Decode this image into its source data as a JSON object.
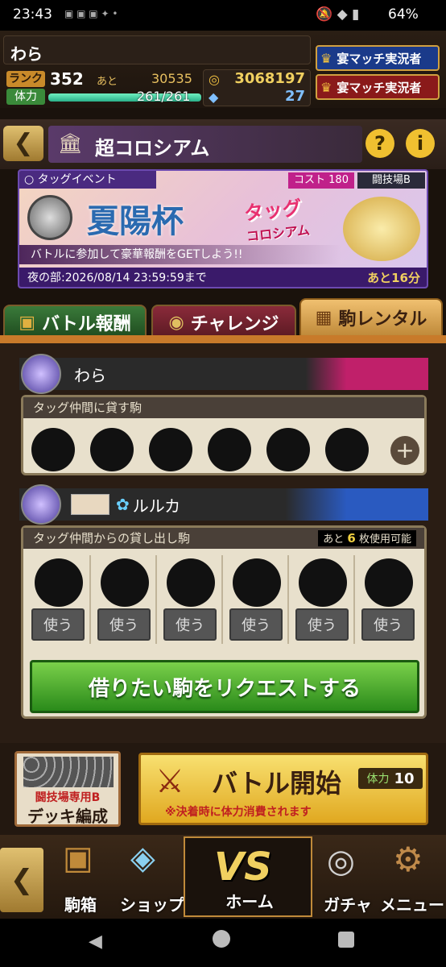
{
  "status": {
    "time": "23:43",
    "battery": "64%"
  },
  "player": {
    "name": "わら",
    "rank_label": "ランク",
    "rank": "352",
    "next_label": "あと",
    "next_value": "30535",
    "stamina_label": "体力",
    "stamina": "261/261",
    "stamina_fraction": 1.0,
    "coins": "3068197",
    "gems": "27"
  },
  "badges": [
    "宴マッチ実況者",
    "宴マッチ実況者"
  ],
  "title": {
    "text": "超コロシアム"
  },
  "banner": {
    "tag": "タッグイベント",
    "cost_label": "コスト",
    "cost": "180",
    "arena": "闘技場B",
    "event_name": "夏陽杯",
    "logo_line1": "タッグ",
    "logo_line2": "コロシアム",
    "subtitle": "バトルに参加して豪華報酬をGETしよう!!",
    "period": "夜の部:2026/08/14 23:59:59まで",
    "remaining": "あと16分"
  },
  "tabs": [
    {
      "label": "バトル報酬"
    },
    {
      "label": "チャレンジ"
    },
    {
      "label": "駒レンタル"
    }
  ],
  "me": {
    "name": "わら",
    "section_label": "タッグ仲間に貸す駒"
  },
  "partner": {
    "name": "ルルカ",
    "section_label": "タッグ仲間からの貸し出し駒",
    "remain_prefix": "あと",
    "remain_count": "6",
    "remain_suffix": "枚使用可能",
    "use_label": "使う"
  },
  "request_button": "借りたい駒をリクエストする",
  "deck": {
    "line1": "闘技場専用B",
    "line2": "デッキ編成"
  },
  "battle": {
    "label": "バトル開始",
    "note": "※決着時に体力消費されます",
    "stamina_label": "体力",
    "stamina_cost": "10"
  },
  "nav": [
    "駒箱",
    "ショップ",
    "ホーム",
    "ガチャ",
    "メニュー"
  ],
  "nav_vs": "VS"
}
